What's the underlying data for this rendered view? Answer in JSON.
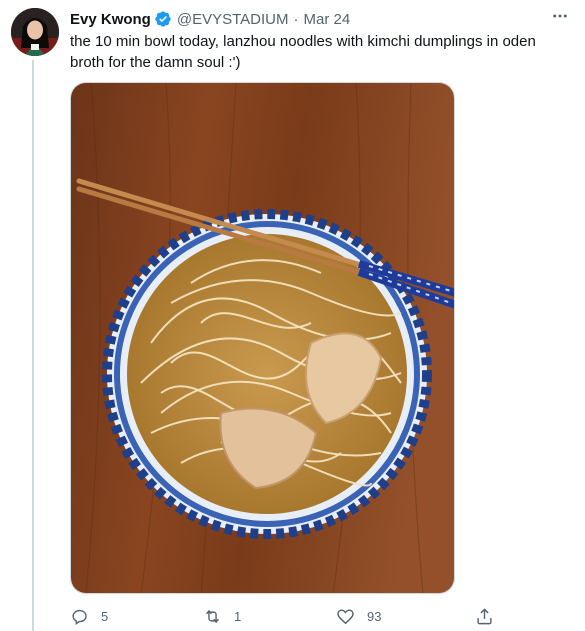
{
  "tweet": {
    "author_name": "Evy Kwong",
    "handle": "@EVYSTADIUM",
    "separator": "·",
    "date": "Mar 24",
    "text": "the 10 min bowl today, lanzhou noodles with kimchi dumplings in oden broth for the damn soul :')",
    "media_alt": "Bowl of lanzhou noodles with dumplings in broth, chopsticks resting on the bowl, on a wooden table",
    "verified": true
  },
  "actions": {
    "reply_count": "5",
    "retweet_count": "1",
    "like_count": "93"
  },
  "icons": {
    "more": "more-horizontal-icon",
    "reply": "reply-icon",
    "retweet": "retweet-icon",
    "like": "heart-icon",
    "share": "share-icon",
    "verified": "verified-badge-icon"
  },
  "colors": {
    "text": "#0f1419",
    "secondary": "#536471",
    "verified_blue": "#1d9bf0",
    "border": "#cfd9de"
  }
}
